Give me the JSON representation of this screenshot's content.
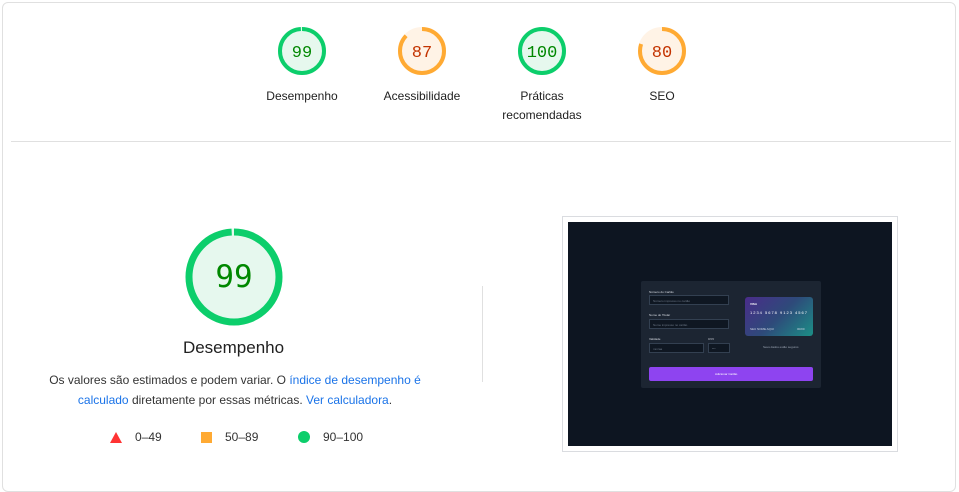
{
  "colors": {
    "pass": "#0cce6b",
    "pass_bg": "#e6f8ee",
    "pass_text": "#008800",
    "average": "#ffaa33",
    "average_bg": "#fff3e6",
    "average_text": "#c33300",
    "fail": "#ff3333",
    "link": "#1a73e8"
  },
  "categories": [
    {
      "score": 99,
      "label": "Desempenho",
      "rating": "pass"
    },
    {
      "score": 87,
      "label": "Acessibilidade",
      "rating": "average"
    },
    {
      "score": 100,
      "label": "Práticas recomendadas",
      "rating": "pass"
    },
    {
      "score": 80,
      "label": "SEO",
      "rating": "average"
    }
  ],
  "main": {
    "score": 99,
    "rating": "pass",
    "title": "Desempenho",
    "desc_1": "Os valores são estimados e podem variar. O ",
    "link_1": "índice de desempenho é calculado",
    "desc_2": " diretamente por essas métricas. ",
    "link_2": "Ver calculadora",
    "desc_3": "."
  },
  "legend": [
    {
      "shape": "triangle",
      "range": "0–49"
    },
    {
      "shape": "square",
      "range": "50–89"
    },
    {
      "shape": "circle",
      "range": "90–100"
    }
  ],
  "screenshot": {
    "card_number_label": "Número do Cartão",
    "card_number_placeholder": "Número impresso no cartão",
    "name_label": "Nome do Titular",
    "name_placeholder": "Nome impresso no cartão",
    "expiry_label": "Validade",
    "expiry_placeholder": "mm/aa",
    "cvv_label": "CVV",
    "cvv_placeholder": "***",
    "card_brand": "VISA",
    "card_number": "1234 5678 9123 4567",
    "card_holder": "SEU NOME AQUI",
    "card_expiry": "00/00",
    "secure_text": "Seus dados estão seguros",
    "button_label": "Adicionar Cartão"
  }
}
